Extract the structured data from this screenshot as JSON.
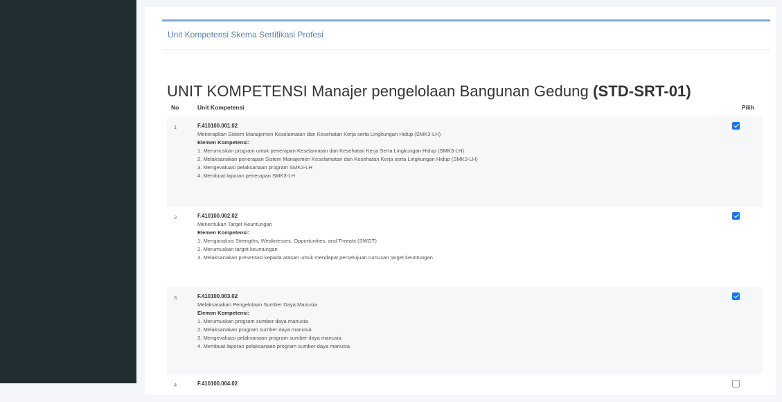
{
  "card": {
    "title": "Unit Kompetensi Skema Sertifikasi Profesi"
  },
  "page": {
    "title_main": "UNIT KOMPETENSI Manajer pengelolaan Bangunan Gedung ",
    "title_code": "(STD-SRT-01)"
  },
  "table": {
    "headers": {
      "no": "No",
      "unit": "Unit Kompetensi",
      "pilih": "Pilih"
    },
    "element_heading": "Elemen Kompetensi:",
    "rows": [
      {
        "no": "1",
        "code": "F.410100.001.02",
        "name": "Menerapkan Sistem Manajemen Keselamatan dan Kesehatan Kerja serta Lingkungan Hidup (SMK3-LH)",
        "elements": [
          "1. Merumuskan program untuk penerapan Keselamatan dan Kesehatan Kerja Serta Lingkungan Hidup (SMK3-LH)",
          "2. Melaksanakan penerapan Sistem Manajemen Keselamatan dan Kesehatan Kerja serta Lingkungan Hidup (SMK3-LH)",
          "3. Mengevaluasi pelaksanaan program SMK3-LH",
          "4. Membuat laporan penerapan SMK3-LH"
        ],
        "checked": true
      },
      {
        "no": "2",
        "code": "F.410100.002.02",
        "name": "Menentukan Target Keuntungan",
        "elements": [
          "1. Menganalisis Strengths, Weaknesses, Opportunities, and Threats (SWOT)",
          "2. Merumuskan target keuntungan",
          "3. Melaksanakan presentasi kepada atasan untuk mendapat persetujuan rumusan target keuntungan"
        ],
        "checked": true
      },
      {
        "no": "3",
        "code": "F.410100.003.02",
        "name": "Melaksanakan Pengelolaan Sumber Daya Manusia",
        "elements": [
          "1. Merumuskan program sumber daya manusia",
          "2. Melaksanakan program sumber daya manusia",
          "3. Mengevaluasi pelaksanaan program sumber daya manusia",
          "4. Membuat laporan pelaksanaan program sumber daya manusia"
        ],
        "checked": true
      },
      {
        "no": "4",
        "code": "F.410100.004.02",
        "name": "",
        "elements": [],
        "checked": false
      }
    ]
  }
}
